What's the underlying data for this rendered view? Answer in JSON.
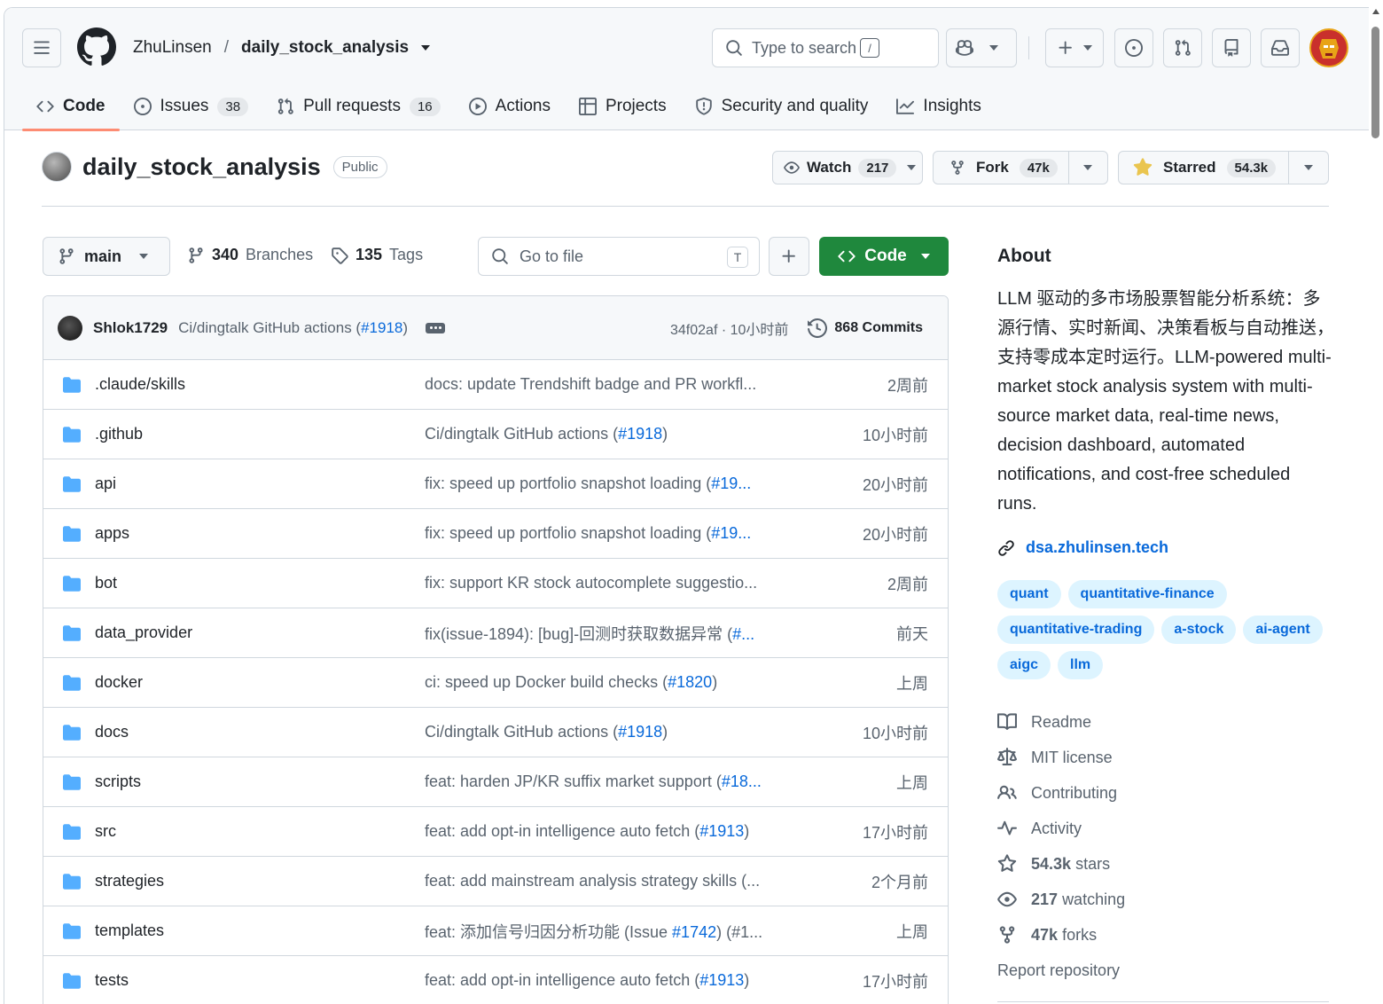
{
  "header": {
    "owner": "ZhuLinsen",
    "repo": "daily_stock_analysis",
    "search_placeholder": "Type to search",
    "search_key": "/"
  },
  "tabs": [
    {
      "label": "Code",
      "count": ""
    },
    {
      "label": "Issues",
      "count": "38"
    },
    {
      "label": "Pull requests",
      "count": "16"
    },
    {
      "label": "Actions",
      "count": ""
    },
    {
      "label": "Projects",
      "count": ""
    },
    {
      "label": "Security and quality",
      "count": ""
    },
    {
      "label": "Insights",
      "count": ""
    }
  ],
  "repo": {
    "name": "daily_stock_analysis",
    "visibility": "Public",
    "watch_label": "Watch",
    "watch_count": "217",
    "fork_label": "Fork",
    "fork_count": "47k",
    "star_label": "Starred",
    "star_count": "54.3k"
  },
  "filenav": {
    "branch": "main",
    "branches_count": "340",
    "branches_label": "Branches",
    "tags_count": "135",
    "tags_label": "Tags",
    "goto_placeholder": "Go to file",
    "goto_key": "T",
    "code_label": "Code"
  },
  "commit": {
    "author": "Shlok1729",
    "message": "Ci/dingtalk GitHub actions (",
    "pr": "#1918",
    "message_end": ")",
    "hash_time": "34f02af · 10小时前",
    "commits": "868 Commits"
  },
  "files": [
    {
      "name": ".claude/skills",
      "msg": "docs: update Trendshift badge and PR workfl...",
      "pr": "",
      "msg_end": "",
      "time": "2周前"
    },
    {
      "name": ".github",
      "msg": "Ci/dingtalk GitHub actions (",
      "pr": "#1918",
      "msg_end": ")",
      "time": "10小时前"
    },
    {
      "name": "api",
      "msg": "fix: speed up portfolio snapshot loading (",
      "pr": "#19...",
      "msg_end": "",
      "time": "20小时前"
    },
    {
      "name": "apps",
      "msg": "fix: speed up portfolio snapshot loading (",
      "pr": "#19...",
      "msg_end": "",
      "time": "20小时前"
    },
    {
      "name": "bot",
      "msg": "fix: support KR stock autocomplete suggestio...",
      "pr": "",
      "msg_end": "",
      "time": "2周前"
    },
    {
      "name": "data_provider",
      "msg": "fix(issue-1894): [bug]-回测时获取数据异常 (",
      "pr": "#...",
      "msg_end": "",
      "time": "前天"
    },
    {
      "name": "docker",
      "msg": "ci: speed up Docker build checks (",
      "pr": "#1820",
      "msg_end": ")",
      "time": "上周"
    },
    {
      "name": "docs",
      "msg": "Ci/dingtalk GitHub actions (",
      "pr": "#1918",
      "msg_end": ")",
      "time": "10小时前"
    },
    {
      "name": "scripts",
      "msg": "feat: harden JP/KR suffix market support (",
      "pr": "#18...",
      "msg_end": "",
      "time": "上周"
    },
    {
      "name": "src",
      "msg": "feat: add opt-in intelligence auto fetch (",
      "pr": "#1913",
      "msg_end": ")",
      "time": "17小时前"
    },
    {
      "name": "strategies",
      "msg": "feat: add mainstream analysis strategy skills (...",
      "pr": "",
      "msg_end": "",
      "time": "2个月前"
    },
    {
      "name": "templates",
      "msg": "feat: 添加信号归因分析功能 (Issue ",
      "pr": "#1742",
      "msg_end": ") (#1...",
      "time": "上周"
    },
    {
      "name": "tests",
      "msg": "feat: add opt-in intelligence auto fetch (",
      "pr": "#1913",
      "msg_end": ")",
      "time": "17小时前"
    }
  ],
  "about": {
    "title": "About",
    "description": "LLM 驱动的多市场股票智能分析系统：多源行情、实时新闻、决策看板与自动推送，支持零成本定时运行。LLM-powered multi-market stock analysis system with multi-source market data, real-time news, decision dashboard, automated notifications, and cost-free scheduled runs.",
    "homepage": "dsa.zhulinsen.tech",
    "topics": [
      "quant",
      "quantitative-finance",
      "quantitative-trading",
      "a-stock",
      "ai-agent",
      "aigc",
      "llm"
    ],
    "links": {
      "readme": "Readme",
      "license": "MIT license",
      "contributing": "Contributing",
      "activity": "Activity",
      "stars_count": "54.3k",
      "stars_label": "stars",
      "watching_count": "217",
      "watching_label": "watching",
      "forks_count": "47k",
      "forks_label": "forks",
      "report": "Report repository"
    }
  },
  "colors": {
    "accent": "#0969da",
    "code_button": "#1f883d",
    "folder": "#54aeff",
    "tab_underline": "#fd8c73",
    "star": "#eac54f"
  }
}
